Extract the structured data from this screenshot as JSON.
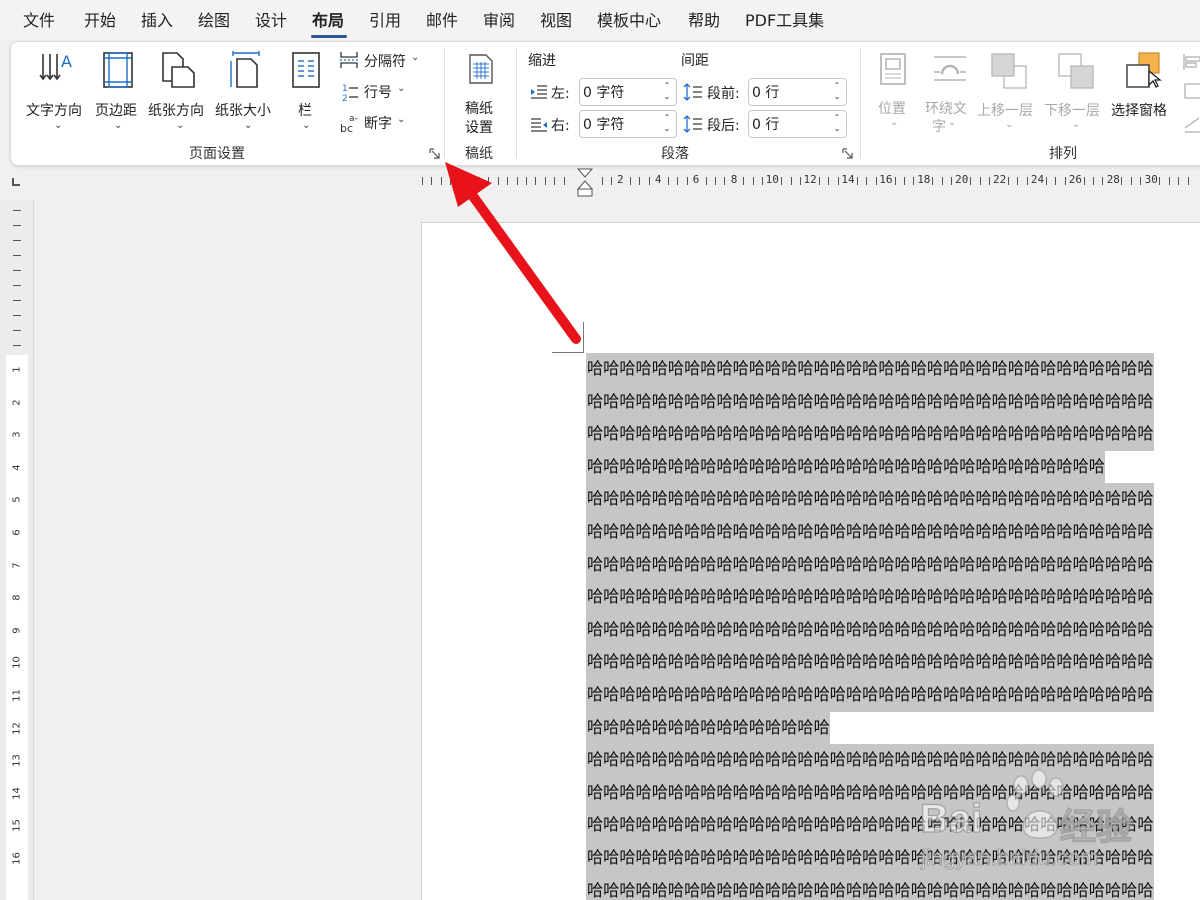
{
  "menu": {
    "items": [
      "文件",
      "开始",
      "插入",
      "绘图",
      "设计",
      "布局",
      "引用",
      "邮件",
      "审阅",
      "视图",
      "模板中心",
      "帮助",
      "PDF工具集"
    ],
    "active": "布局"
  },
  "ribbon": {
    "page_setup": {
      "text_direction": "文字方向",
      "margins": "页边距",
      "orientation": "纸张方向",
      "size": "纸张大小",
      "columns": "栏",
      "breaks": "分隔符",
      "line_numbers": "行号",
      "hyphenation": "断字",
      "group_label": "页面设置"
    },
    "manuscript": {
      "setup_line1": "稿纸",
      "setup_line2": "设置",
      "group_label": "稿纸"
    },
    "paragraph": {
      "indent_title": "缩进",
      "spacing_title": "间距",
      "left_label": "左:",
      "right_label": "右:",
      "before_label": "段前:",
      "after_label": "段后:",
      "left_value": "0 字符",
      "right_value": "0 字符",
      "before_value": "0 行",
      "after_value": "0 行",
      "group_label": "段落"
    },
    "arrange": {
      "position": "位置",
      "wrap_line1": "环绕文",
      "wrap_line2": "字",
      "bring_forward": "上移一层",
      "send_backward": "下移一层",
      "selection_pane": "选择窗格",
      "group_label": "排列"
    }
  },
  "ruler": {
    "labels": [
      "2",
      "4",
      "6",
      "8",
      "10",
      "12",
      "14",
      "16",
      "18",
      "20",
      "22",
      "24",
      "26",
      "28",
      "30"
    ],
    "vertical_labels": [
      "1",
      "2",
      "3",
      "4",
      "5",
      "6",
      "7",
      "8",
      "9",
      "10",
      "11",
      "12",
      "13",
      "14",
      "15",
      "16"
    ]
  },
  "document": {
    "lines": [
      "哈哈哈哈哈哈哈哈哈哈哈哈哈哈哈哈哈哈哈哈哈哈哈哈哈哈哈哈哈哈哈哈哈哈哈",
      "哈哈哈哈哈哈哈哈哈哈哈哈哈哈哈哈哈哈哈哈哈哈哈哈哈哈哈哈哈哈哈哈哈哈哈",
      "哈哈哈哈哈哈哈哈哈哈哈哈哈哈哈哈哈哈哈哈哈哈哈哈哈哈哈哈哈哈哈哈哈哈哈",
      "哈哈哈哈哈哈哈哈哈哈哈哈哈哈哈哈哈哈哈哈哈哈哈哈哈哈哈哈哈哈哈哈",
      "哈哈哈哈哈哈哈哈哈哈哈哈哈哈哈哈哈哈哈哈哈哈哈哈哈哈哈哈哈哈哈哈哈哈哈",
      "哈哈哈哈哈哈哈哈哈哈哈哈哈哈哈哈哈哈哈哈哈哈哈哈哈哈哈哈哈哈哈哈哈哈哈",
      "哈哈哈哈哈哈哈哈哈哈哈哈哈哈哈哈哈哈哈哈哈哈哈哈哈哈哈哈哈哈哈哈哈哈哈",
      "哈哈哈哈哈哈哈哈哈哈哈哈哈哈哈哈哈哈哈哈哈哈哈哈哈哈哈哈哈哈哈哈哈哈哈",
      "哈哈哈哈哈哈哈哈哈哈哈哈哈哈哈哈哈哈哈哈哈哈哈哈哈哈哈哈哈哈哈哈哈哈哈",
      "哈哈哈哈哈哈哈哈哈哈哈哈哈哈哈哈哈哈哈哈哈哈哈哈哈哈哈哈哈哈哈哈哈哈哈",
      "哈哈哈哈哈哈哈哈哈哈哈哈哈哈哈哈哈哈哈哈哈哈哈哈哈哈哈哈哈哈哈哈哈哈哈",
      "哈哈哈哈哈哈哈哈哈哈哈哈哈哈哈",
      "哈哈哈哈哈哈哈哈哈哈哈哈哈哈哈哈哈哈哈哈哈哈哈哈哈哈哈哈哈哈哈哈哈哈哈",
      "哈哈哈哈哈哈哈哈哈哈哈哈哈哈哈哈哈哈哈哈哈哈哈哈哈哈哈哈哈哈哈哈哈哈哈",
      "哈哈哈哈哈哈哈哈哈哈哈哈哈哈哈哈哈哈哈哈哈哈哈哈哈哈哈哈哈哈哈哈哈哈哈",
      "哈哈哈哈哈哈哈哈哈哈哈哈哈哈哈哈哈哈哈哈哈哈哈哈哈哈哈哈哈哈哈哈哈哈哈",
      "哈哈哈哈哈哈哈哈哈哈哈哈哈哈哈哈哈哈哈哈哈哈哈哈哈哈哈哈哈哈哈哈哈哈哈"
    ]
  },
  "watermark": {
    "brand": "Bai",
    "brand_cn": "经验",
    "url": "jingyan.baidu.com"
  },
  "colors": {
    "annotation_arrow": "#e8121a",
    "selection_highlight": "#c6c6c6",
    "active_tab_underline": "#2b579a",
    "icon_blue": "#1e6fc7"
  }
}
